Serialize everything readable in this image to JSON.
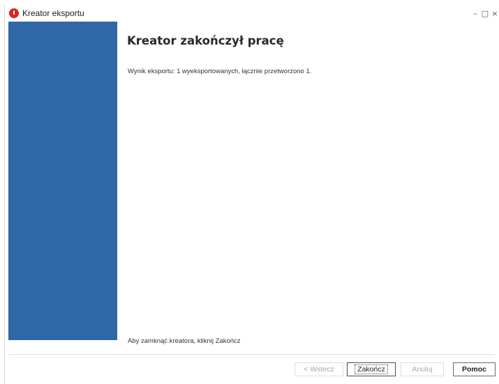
{
  "window": {
    "title": "Kreator eksportu",
    "controls": {
      "minimize": "–",
      "maximize": "□",
      "close": "×"
    }
  },
  "wizard": {
    "heading": "Kreator zakończył pracę",
    "result": "Wynik eksportu: 1 wyeksportowanych, łącznie przetworzono 1.",
    "hint": "Aby zamknąć kreatora, kliknij Zakończ"
  },
  "buttons": {
    "back": "< Wstecz",
    "finish": "Zakończ",
    "cancel": "Anuluj",
    "help": "Pomoc"
  },
  "colors": {
    "sidebar": "#3068a7",
    "app_icon": "#d8261c"
  }
}
